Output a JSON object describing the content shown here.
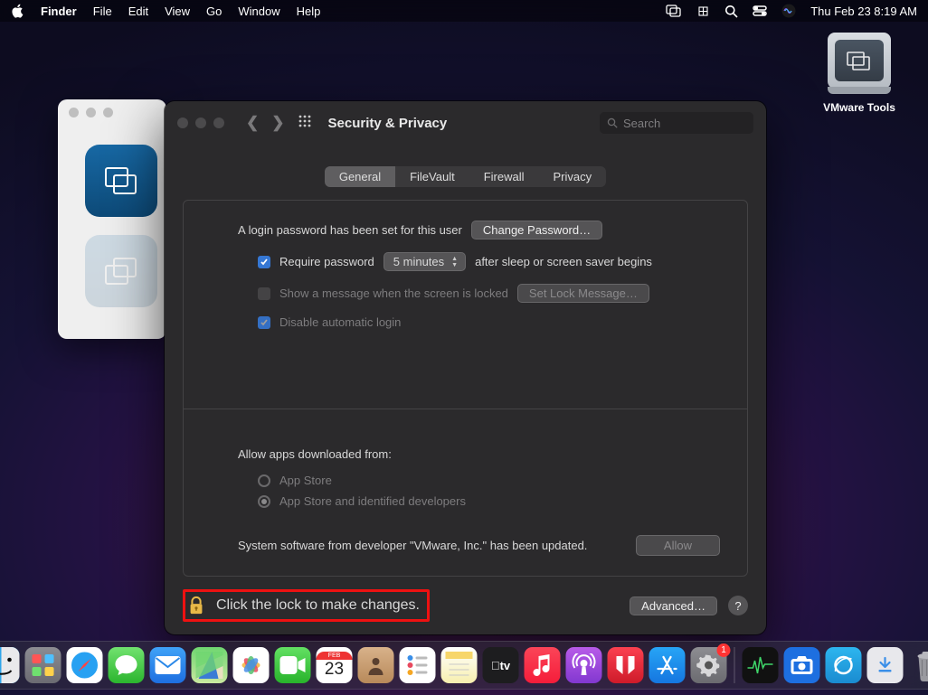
{
  "menubar": {
    "app": "Finder",
    "items": [
      "File",
      "Edit",
      "View",
      "Go",
      "Window",
      "Help"
    ],
    "datetime": "Thu Feb 23  8:19 AM"
  },
  "desktop": {
    "vmware_label": "VMware Tools"
  },
  "pref": {
    "title": "Security & Privacy",
    "search_placeholder": "Search",
    "tabs": [
      "General",
      "FileVault",
      "Firewall",
      "Privacy"
    ],
    "active_tab": 0,
    "login_pw_text": "A login password has been set for this user",
    "change_pw": "Change Password…",
    "require_pw_label": "Require password",
    "require_pw_delay": "5 minutes",
    "after_sleep": "after sleep or screen saver begins",
    "show_message": "Show a message when the screen is locked",
    "set_lock_msg": "Set Lock Message…",
    "disable_auto_login": "Disable automatic login",
    "allow_header": "Allow apps downloaded from:",
    "opt_appstore": "App Store",
    "opt_identified": "App Store and identified developers",
    "system_software": "System software from developer \"VMware, Inc.\" has been updated.",
    "allow_btn": "Allow",
    "lock_text": "Click the lock to make changes.",
    "advanced": "Advanced…"
  },
  "dock": {
    "cal_month": "FEB",
    "cal_day": "23",
    "sysprefs_badge": "1"
  }
}
